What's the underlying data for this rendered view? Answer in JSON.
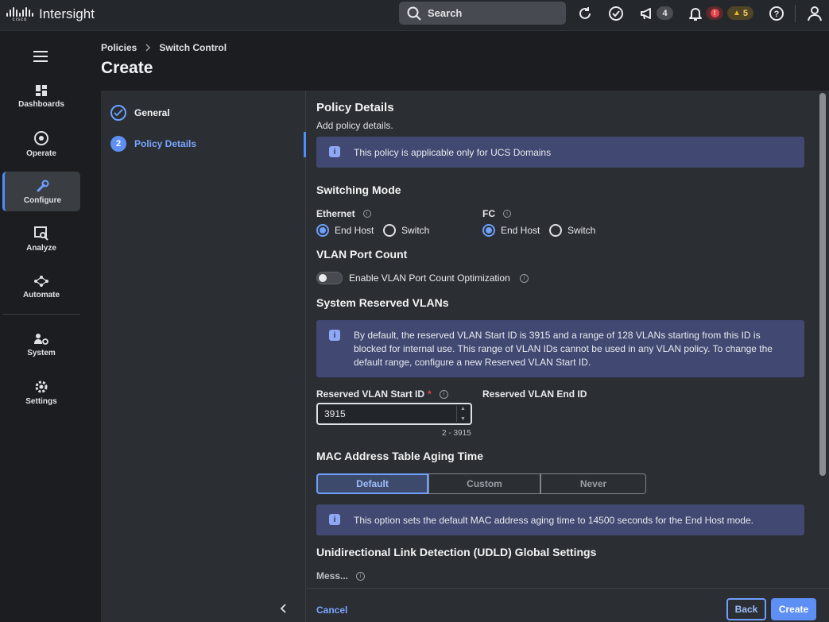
{
  "app": {
    "brand": "cisco",
    "title": "Intersight"
  },
  "topbar": {
    "search_label": "Search",
    "announcements_count": "4",
    "alerts_critical": "!",
    "alerts_warning_count": "5",
    "icons": [
      "refresh-icon",
      "tasks-check-icon",
      "megaphone-icon",
      "bell-icon",
      "help-icon",
      "user-icon"
    ]
  },
  "sidebar": {
    "items": [
      {
        "label": "Dashboards",
        "icon": "dashboards-icon"
      },
      {
        "label": "Operate",
        "icon": "operate-icon"
      },
      {
        "label": "Configure",
        "icon": "configure-icon",
        "active": true
      },
      {
        "label": "Analyze",
        "icon": "analyze-icon"
      },
      {
        "label": "Automate",
        "icon": "automate-icon"
      },
      {
        "label": "System",
        "icon": "system-icon"
      },
      {
        "label": "Settings",
        "icon": "settings-icon"
      }
    ]
  },
  "header": {
    "breadcrumb": [
      "Policies",
      "Switch Control"
    ],
    "title": "Create"
  },
  "steps": [
    {
      "label": "General",
      "state": "complete"
    },
    {
      "number": "2",
      "label": "Policy Details",
      "state": "active"
    }
  ],
  "policy_details": {
    "title": "Policy Details",
    "subtitle": "Add policy details.",
    "applicability_note": "This policy is applicable only for UCS Domains"
  },
  "switching_mode": {
    "title": "Switching Mode",
    "ethernet": {
      "label": "Ethernet",
      "options": [
        "End Host",
        "Switch"
      ],
      "selected": "End Host"
    },
    "fc": {
      "label": "FC",
      "options": [
        "End Host",
        "Switch"
      ],
      "selected": "End Host"
    }
  },
  "vlan_port_count": {
    "title": "VLAN Port Count",
    "toggle_label": "Enable VLAN Port Count Optimization",
    "enabled": false
  },
  "system_reserved_vlans": {
    "title": "System Reserved VLANs",
    "info": "By default, the reserved VLAN Start ID is 3915 and a range of 128 VLANs starting from this ID is blocked for internal use. This range of VLAN IDs cannot be used in any VLAN policy. To change the default range, configure a new Reserved VLAN Start ID.",
    "start_label": "Reserved VLAN Start ID",
    "required_mark": "*",
    "start_value": "3915",
    "start_range_hint": "2 - 3915",
    "end_label": "Reserved VLAN End ID"
  },
  "mac_aging": {
    "title": "MAC Address Table Aging Time",
    "options": [
      "Default",
      "Custom",
      "Never"
    ],
    "selected": "Default",
    "info": "This option sets the default MAC address aging time to 14500 seconds for the End Host mode."
  },
  "udld": {
    "title": "Unidirectional Link Detection (UDLD) Global Settings",
    "field_label": "Mess..."
  },
  "footer": {
    "cancel": "Cancel",
    "back": "Back",
    "create": "Create"
  },
  "colors": {
    "accent": "#5d8ff5",
    "info_bg": "#414871",
    "warning": "#e8b923",
    "critical": "#e8444a"
  }
}
